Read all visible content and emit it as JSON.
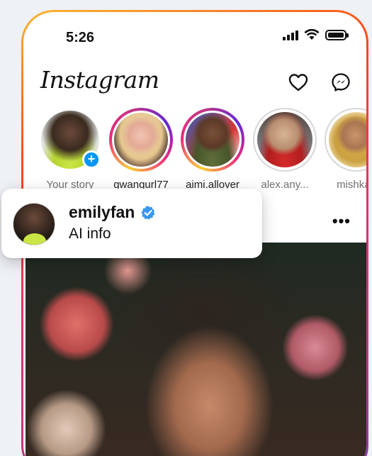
{
  "status_bar": {
    "time": "5:26"
  },
  "header": {
    "logo_text": "Instagram"
  },
  "stories": [
    {
      "label": "Your story",
      "state": "own",
      "colors": [
        "#3a2a20",
        "#c9e645"
      ]
    },
    {
      "label": "gwangurl77",
      "state": "active",
      "colors": [
        "#e9d3a8",
        "#f2c4b4"
      ]
    },
    {
      "label": "aimi.allover",
      "state": "active",
      "colors": [
        "#2f2a26",
        "#6a7a3a"
      ]
    },
    {
      "label": "alex.any...",
      "state": "seen",
      "colors": [
        "#c8a88a",
        "#d62a2a"
      ]
    },
    {
      "label": "mishka_",
      "state": "seen",
      "colors": [
        "#e0b04a",
        "#f0d9a0"
      ]
    }
  ],
  "popup": {
    "username": "emilyfan",
    "subtitle": "AI info"
  },
  "colors": {
    "accent_blue": "#0095f6",
    "verified_blue": "#3897f0",
    "text": "#111111",
    "muted": "#707070"
  }
}
